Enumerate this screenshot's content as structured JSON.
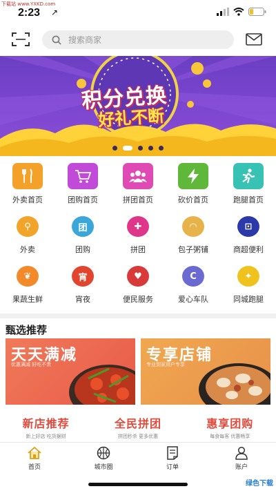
{
  "status": {
    "watermark": "下载站 www.YXKD.com",
    "time": "2:23",
    "location_arrow": "↗"
  },
  "header": {
    "search_placeholder": "搜索商家"
  },
  "banner": {
    "line1": "积分兑换",
    "line2": "好礼不断",
    "dot_count": 5,
    "active_dot": 1
  },
  "categories": [
    {
      "label": "外卖首页",
      "icon": "fork-knife-icon",
      "color": "#f4a12a"
    },
    {
      "label": "团购首页",
      "icon": "cart-icon",
      "color": "#c24ad8"
    },
    {
      "label": "拼团首页",
      "icon": "group-icon",
      "color": "#e04ab4"
    },
    {
      "label": "砍价首页",
      "icon": "lightning-icon",
      "color": "#5fb83a"
    },
    {
      "label": "跑腿首页",
      "icon": "runner-icon",
      "color": "#38c2b4"
    }
  ],
  "sub_row1": [
    {
      "label": "外卖",
      "icon": "scooter-icon",
      "color": "#f0a42a",
      "glyph": "⚲"
    },
    {
      "label": "团购",
      "icon": "tuan-icon",
      "color": "#3ba6d8",
      "glyph": "团"
    },
    {
      "label": "拼团",
      "icon": "puzzle-icon",
      "color": "#e0368a",
      "glyph": "✚"
    },
    {
      "label": "包子粥铺",
      "icon": "bun-icon",
      "color": "#e8b24a",
      "glyph": "◠"
    },
    {
      "label": "商超便利",
      "icon": "basket-icon",
      "color": "#2b3aa8",
      "glyph": "⊡"
    }
  ],
  "sub_row2": [
    {
      "label": "果蔬生鲜",
      "icon": "fruit-icon",
      "color": "#f28a2a",
      "glyph": "❦"
    },
    {
      "label": "宵夜",
      "icon": "night-icon",
      "color": "#e2452e",
      "glyph": "宵"
    },
    {
      "label": "便民服务",
      "icon": "heart-hand-icon",
      "color": "#d83a3a",
      "glyph": "♥"
    },
    {
      "label": "爱心车队",
      "icon": "car-icon",
      "color": "#6a6ad0",
      "glyph": "C"
    },
    {
      "label": "同城跑腿",
      "icon": "run-icon",
      "color": "#f0c21e",
      "glyph": "✦"
    }
  ],
  "section": {
    "title": "甄选推荐"
  },
  "promos": [
    {
      "title": "天天满减",
      "subtitle": "优惠满减 好吃不贵"
    },
    {
      "title": "专享店铺",
      "subtitle": "专业到家用户专享"
    }
  ],
  "small_cards": [
    {
      "title": "新店推荐",
      "subtitle": "新上好店 吃货据财"
    },
    {
      "title": "全民拼团",
      "subtitle": "拼团秒杀 更多优惠"
    },
    {
      "title": "惠享团购",
      "subtitle": "每食每客 优惠畅享"
    }
  ],
  "tabs": [
    {
      "label": "首页",
      "icon": "home-icon"
    },
    {
      "label": "城市圈",
      "icon": "basketball-icon"
    },
    {
      "label": "订单",
      "icon": "order-icon"
    },
    {
      "label": "账户",
      "icon": "user-icon"
    }
  ],
  "corner_logo": "绿色下载",
  "colors": {
    "accent_red": "#e24a3c",
    "banner_purple": "#7a45cf",
    "banner_yellow": "#ffd23a"
  }
}
